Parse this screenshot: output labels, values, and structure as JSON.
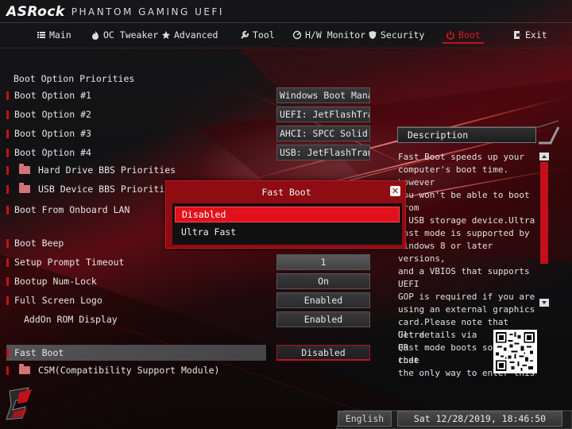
{
  "brand": {
    "name": "ASRock",
    "subtitle": "PHANTOM GAMING UEFI"
  },
  "nav": {
    "items": [
      {
        "label": "Main",
        "icon": "list-icon"
      },
      {
        "label": "OC Tweaker",
        "icon": "flame-icon"
      },
      {
        "label": "Advanced",
        "icon": "star-icon"
      },
      {
        "label": "Tool",
        "icon": "wrench-icon"
      },
      {
        "label": "H/W Monitor",
        "icon": "monitor-icon"
      },
      {
        "label": "Security",
        "icon": "shield-icon"
      },
      {
        "label": "Boot",
        "icon": "power-icon",
        "active": true
      },
      {
        "label": "Exit",
        "icon": "exit-icon"
      }
    ]
  },
  "settings": {
    "section_title": "Boot Option Priorities",
    "boot_option_1": {
      "label": "Boot Option #1",
      "value": "Windows Boot Mana..."
    },
    "boot_option_2": {
      "label": "Boot Option #2",
      "value": "UEFI: JetFlashTra..."
    },
    "boot_option_3": {
      "label": "Boot Option #3",
      "value": "AHCI:  SPCC Solid..."
    },
    "boot_option_4": {
      "label": "Boot Option #4",
      "value": "USB: JetFlashTran..."
    },
    "hdd_bbs": {
      "label": "Hard Drive BBS Priorities"
    },
    "usb_bbs": {
      "label": "USB Device BBS Priorities"
    },
    "onboard_lan": {
      "label": "Boot From Onboard LAN"
    },
    "boot_beep": {
      "label": "Boot Beep"
    },
    "setup_prompt_timeout": {
      "label": "Setup Prompt Timeout",
      "value": "1"
    },
    "bootup_numlock": {
      "label": "Bootup Num-Lock",
      "value": "On"
    },
    "full_screen_logo": {
      "label": "Full Screen Logo",
      "value": "Enabled"
    },
    "addon_rom_display": {
      "label": "AddOn ROM Display",
      "value": "Enabled"
    },
    "fast_boot": {
      "label": "Fast Boot",
      "value": "Disabled"
    },
    "csm": {
      "label": "CSM(Compatibility Support Module)"
    }
  },
  "description": {
    "title": "Description",
    "lines": [
      "Fast Boot speeds up your",
      "computer's boot time. however",
      "you won't be able to boot from",
      "a USB storage device.Ultra",
      "Fast mode is supported by",
      "Windows 8 or later versions,",
      "and a VBIOS that supports UEFI",
      "GOP is required if you are",
      "using an external graphics",
      "card.Please note that Ultra",
      "Fast mode boots so fast that",
      "the only way to enter this"
    ],
    "qr_lines": [
      "Get details via QR",
      "code"
    ]
  },
  "modal": {
    "title": "Fast Boot",
    "options": [
      "Disabled",
      "Ultra Fast"
    ],
    "selected_index": 0
  },
  "footer": {
    "language": "English",
    "datetime": "Sat 12/28/2019, 18:46:50"
  },
  "colors": {
    "accent": "#c4101a",
    "modal_bg": "#8e0c12",
    "selected_option": "#e2101a"
  }
}
